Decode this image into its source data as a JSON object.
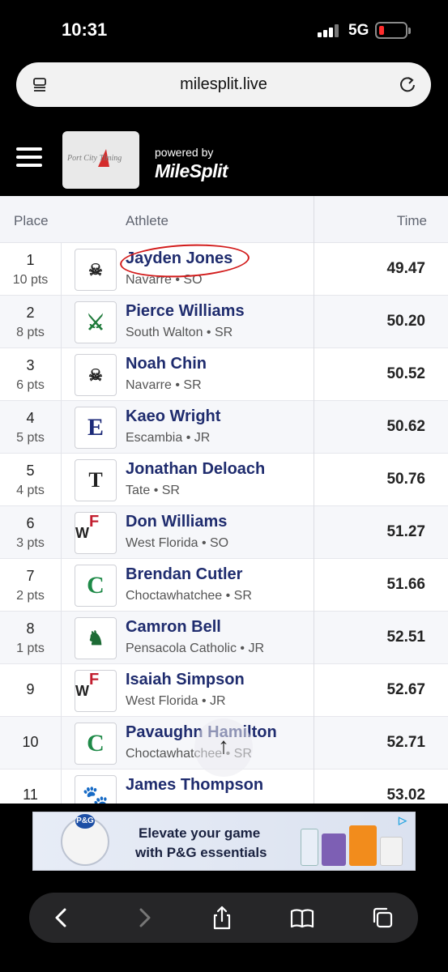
{
  "status": {
    "time": "10:31",
    "network": "5G"
  },
  "browser": {
    "url": "milesplit.live"
  },
  "header": {
    "powered_by": "powered by",
    "brand": "MileSplit",
    "logo_text": "Port City Timing"
  },
  "table": {
    "headers": {
      "place": "Place",
      "athlete": "Athlete",
      "time": "Time"
    },
    "rows": [
      {
        "place": "1",
        "pts": "10 pts",
        "name": "Jayden Jones",
        "school": "Navarre • SO",
        "time": "49.47"
      },
      {
        "place": "2",
        "pts": "8 pts",
        "name": "Pierce Williams",
        "school": "South Walton • SR",
        "time": "50.20"
      },
      {
        "place": "3",
        "pts": "6 pts",
        "name": "Noah Chin",
        "school": "Navarre • SR",
        "time": "50.52"
      },
      {
        "place": "4",
        "pts": "5 pts",
        "name": "Kaeo Wright",
        "school": "Escambia • JR",
        "time": "50.62"
      },
      {
        "place": "5",
        "pts": "4 pts",
        "name": "Jonathan Deloach",
        "school": "Tate • SR",
        "time": "50.76"
      },
      {
        "place": "6",
        "pts": "3 pts",
        "name": "Don Williams",
        "school": "West Florida • SO",
        "time": "51.27"
      },
      {
        "place": "7",
        "pts": "2 pts",
        "name": "Brendan Cutler",
        "school": "Choctawhatchee • SR",
        "time": "51.66"
      },
      {
        "place": "8",
        "pts": "1 pts",
        "name": "Camron Bell",
        "school": "Pensacola Catholic • JR",
        "time": "52.51"
      },
      {
        "place": "9",
        "pts": "",
        "name": "Isaiah Simpson",
        "school": "West Florida • JR",
        "time": "52.67"
      },
      {
        "place": "10",
        "pts": "",
        "name": "Pavaughn Hamilton",
        "school": "Choctawhatchee • SR",
        "time": "52.71"
      },
      {
        "place": "11",
        "pts": "",
        "name": "James Thompson",
        "school": "",
        "time": "53.02"
      }
    ]
  },
  "ad": {
    "line1": "Elevate your game",
    "line2": "with P&G essentials",
    "badge": "P&G"
  },
  "colors": {
    "athlete_link": "#1f2c6e",
    "annotation": "#d21a1a"
  }
}
